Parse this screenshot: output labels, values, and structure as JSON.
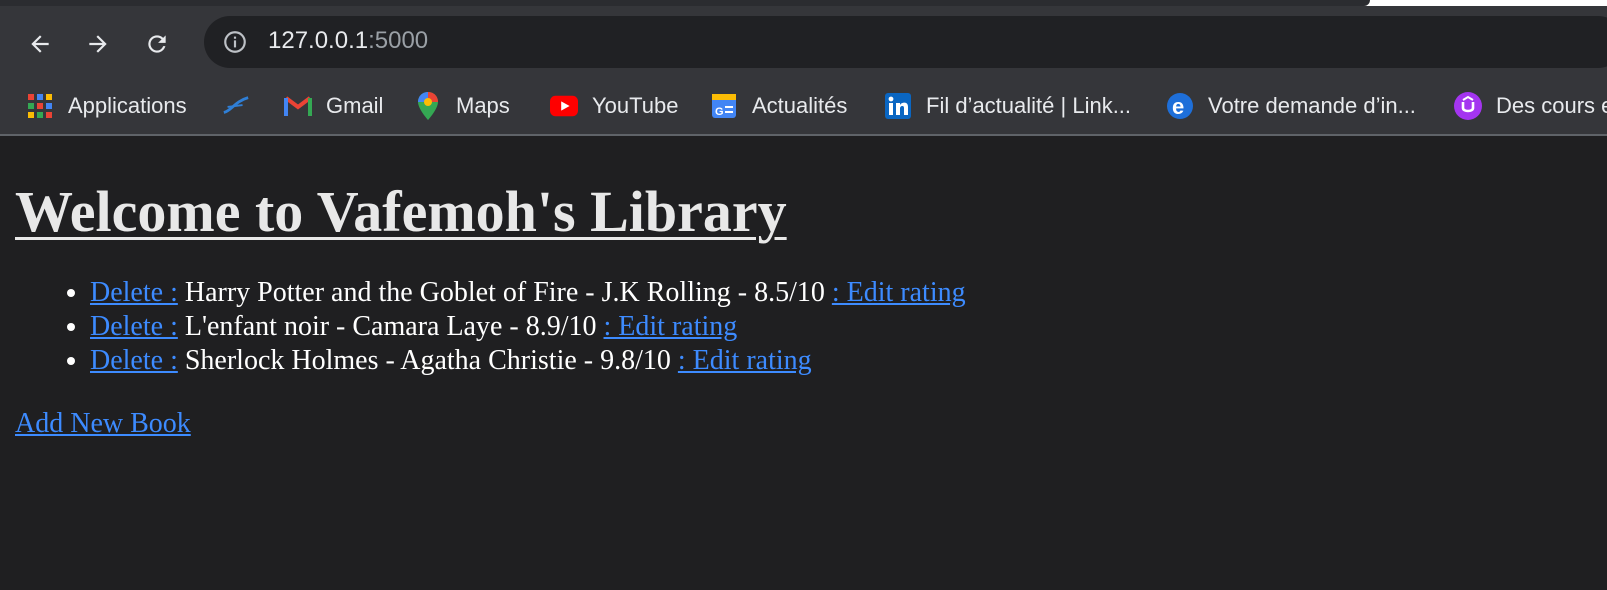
{
  "browser": {
    "url_host": "127.0.0.1",
    "url_port": ":5000"
  },
  "bookmarks": [
    {
      "label": "Applications",
      "icon": "apps-grid-icon"
    },
    {
      "label": "",
      "icon": "swoosh-icon"
    },
    {
      "label": "Gmail",
      "icon": "gmail-icon"
    },
    {
      "label": "Maps",
      "icon": "maps-pin-icon"
    },
    {
      "label": "YouTube",
      "icon": "youtube-icon"
    },
    {
      "label": "Actualités",
      "icon": "google-news-icon"
    },
    {
      "label": "Fil d’actualité | Link...",
      "icon": "linkedin-icon"
    },
    {
      "label": "Votre demande d’in...",
      "icon": "edge-icon"
    },
    {
      "label": "Des cours e",
      "icon": "udemy-icon"
    }
  ],
  "page": {
    "title": "Welcome to Vafemoh's Library",
    "books": [
      {
        "delete_label": "Delete :",
        "text": " Harry Potter and the Goblet of Fire - J.K Rolling - 8.5/10 ",
        "edit_label": ": Edit rating"
      },
      {
        "delete_label": "Delete :",
        "text": " L'enfant noir - Camara Laye - 8.9/10 ",
        "edit_label": ": Edit rating"
      },
      {
        "delete_label": "Delete :",
        "text": " Sherlock Holmes - Agatha Christie - 9.8/10 ",
        "edit_label": ": Edit rating"
      }
    ],
    "add_label": "Add New Book"
  },
  "colors": {
    "page_bg": "#1f1f21",
    "toolbar_bg": "#35363a",
    "link": "#3d8bff"
  }
}
